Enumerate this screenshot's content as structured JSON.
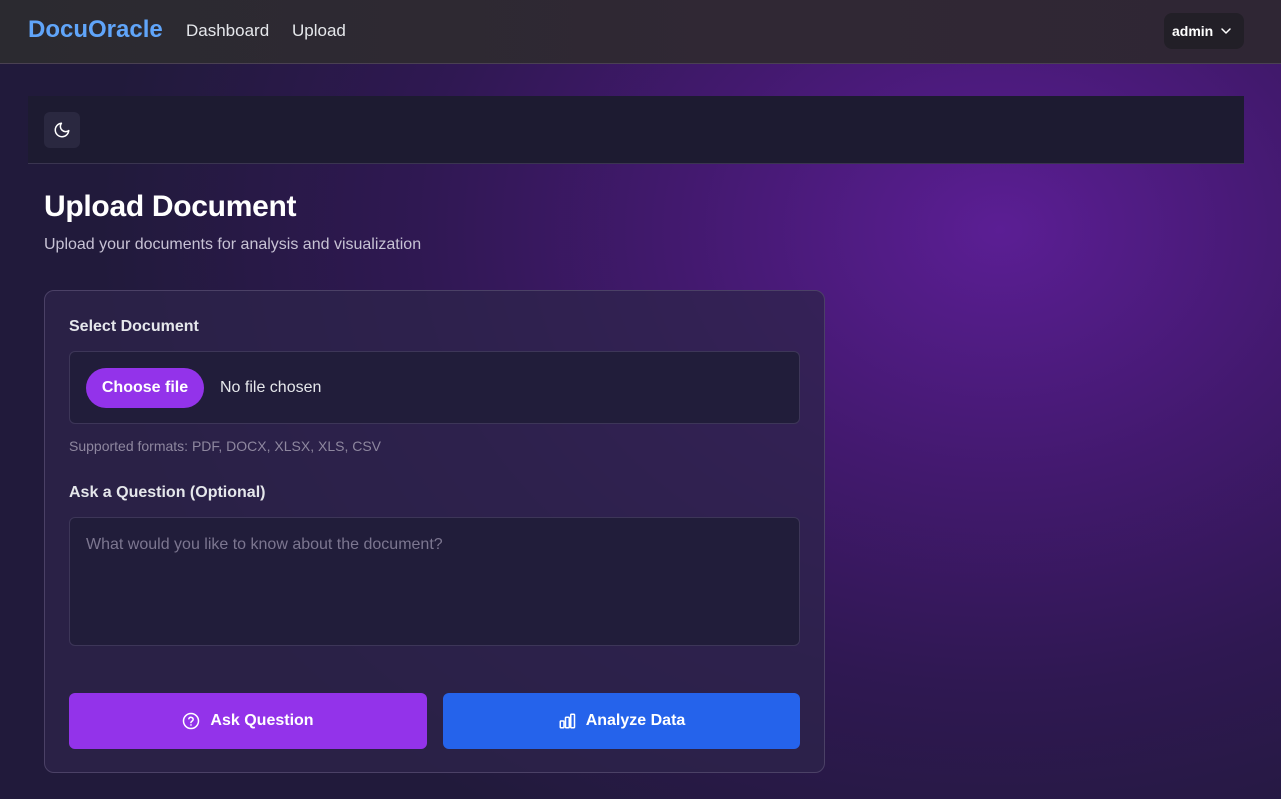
{
  "header": {
    "brand": "DocuOracle",
    "nav": [
      {
        "label": "Dashboard"
      },
      {
        "label": "Upload"
      }
    ],
    "user": {
      "name": "admin",
      "menu_icon": "chevron-down-icon"
    }
  },
  "toolbar": {
    "theme_toggle_icon": "moon-icon"
  },
  "page": {
    "title": "Upload Document",
    "subtitle": "Upload your documents for analysis and visualization"
  },
  "form": {
    "document_label": "Select Document",
    "choose_file_label": "Choose file",
    "file_status": "No file chosen",
    "supported_formats": "Supported formats: PDF, DOCX, XLSX, XLS, CSV",
    "question_label": "Ask a Question (Optional)",
    "question_placeholder": "What would you like to know about the document?",
    "question_value": "",
    "ask_button_label": "Ask Question",
    "ask_button_icon": "question-circle-icon",
    "analyze_button_label": "Analyze Data",
    "analyze_button_icon": "bar-chart-icon"
  },
  "colors": {
    "brand": "#60a5fa",
    "primary_purple": "#9333ea",
    "primary_blue": "#2563eb"
  }
}
